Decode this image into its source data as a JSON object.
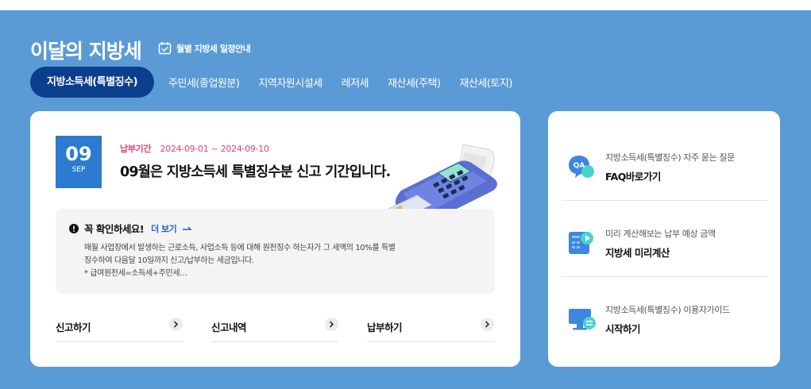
{
  "header": {
    "title": "이달의 지방세",
    "schedule_link": "월별 지방세 일정안내"
  },
  "tabs": [
    {
      "label": "지방소득세(특별징수)",
      "active": true
    },
    {
      "label": "주민세(종업원분)",
      "active": false
    },
    {
      "label": "지역자원시설세",
      "active": false
    },
    {
      "label": "레저세",
      "active": false
    },
    {
      "label": "재산세(주택)",
      "active": false
    },
    {
      "label": "재산세(토지)",
      "active": false
    }
  ],
  "main": {
    "date": {
      "day": "09",
      "month": "SEP"
    },
    "period_label": "납부기간",
    "period_value": "2024-09-01 ~ 2024-09-10",
    "headline": "09월은 지방소득세 특별징수분 신고 기간입니다.",
    "notice": {
      "title": "꼭 확인하세요!",
      "more_link": "더 보기",
      "lines": [
        "매월 사업장에서 발생하는 근로소득, 사업소득 등에 대해 원천징수 하는자가 그 세액의 10%를 특별",
        "징수하여 다음달 10일까지 신고/납부하는 세금입니다.",
        "* 급여원천세=소득세+주민세…"
      ]
    },
    "actions": [
      {
        "label": "신고하기"
      },
      {
        "label": "신고내역"
      },
      {
        "label": "납부하기"
      }
    ]
  },
  "side": {
    "items": [
      {
        "icon": "qa-icon",
        "sub": "지방소득세(특별징수) 자주 묻는 질문",
        "main": "FAQ바로가기"
      },
      {
        "icon": "calculator-play-icon",
        "sub": "미리 계산해보는 납부 예상 금액",
        "main": "지방세 미리계산"
      },
      {
        "icon": "monitor-guide-icon",
        "sub": "지방소득세(특별징수) 이용자가이드",
        "main": "시작하기"
      }
    ]
  },
  "colors": {
    "panel_bg": "#5b9bd5",
    "active_tab": "#0b3f8e",
    "date_box": "#2d7bd0",
    "period_text": "#e0407b",
    "link": "#1f5fbf"
  }
}
